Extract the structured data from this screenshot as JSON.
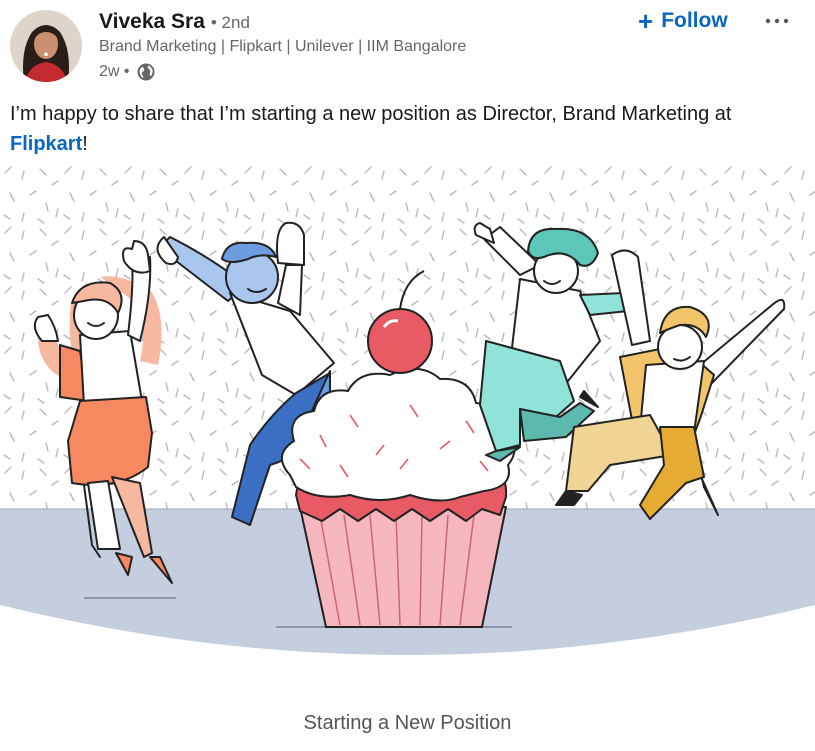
{
  "actor": {
    "name": "Viveka Sra",
    "degree": "• 2nd",
    "headline": "Brand Marketing | Flipkart | Unilever | IIM Bangalore",
    "time": "2w •",
    "visibility_icon": "globe-icon",
    "avatar_icon": "profile-photo"
  },
  "actions": {
    "follow_label": "Follow",
    "follow_icon": "plus-icon",
    "more_label": "···"
  },
  "commentary": {
    "text_before": "I’m happy to share that I’m starting a new position as Director, Brand Marketing at ",
    "mention": "Flipkart",
    "text_after": "!"
  },
  "image": {
    "caption": "Starting a New Position"
  },
  "colors": {
    "accent": "#0a66c2",
    "floor": "#c5cedf",
    "cherry": "#e85a64",
    "cupcake_liner": "#f5b7bd"
  }
}
